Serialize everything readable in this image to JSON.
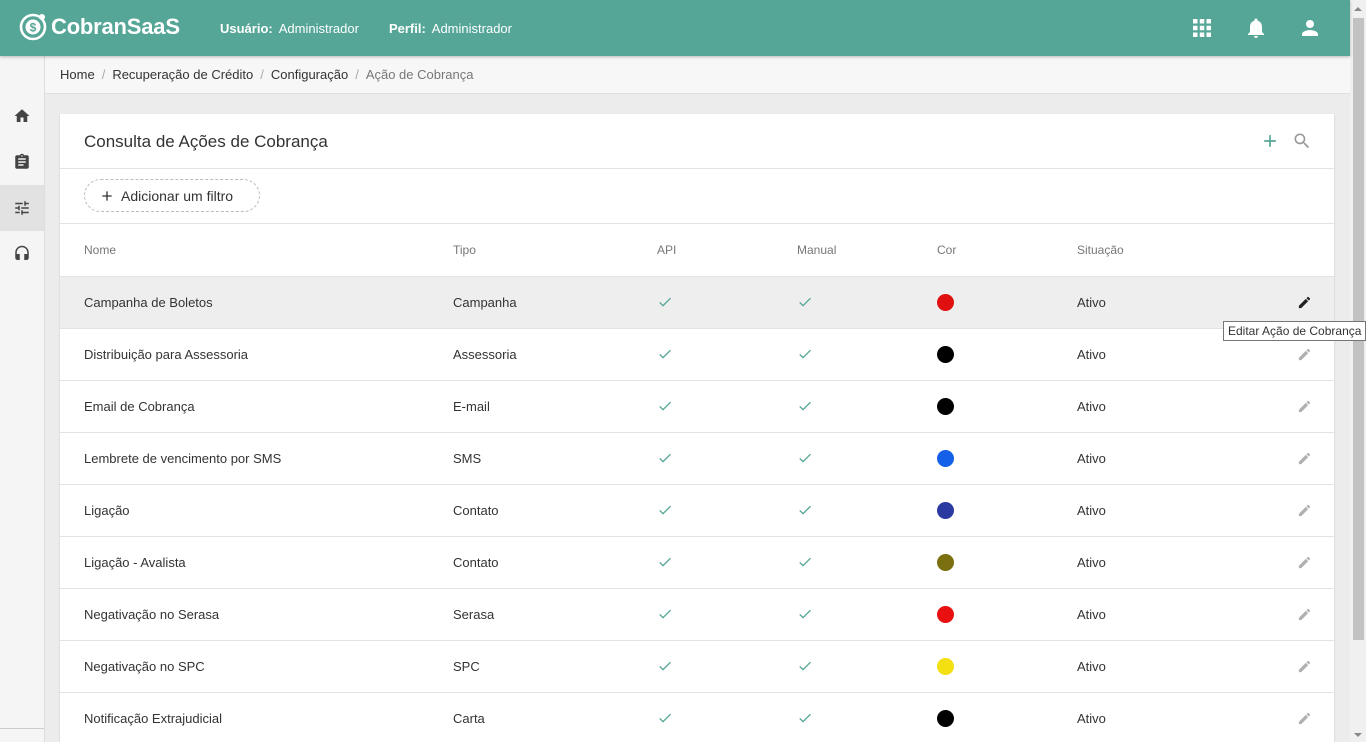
{
  "app": {
    "logo_text": "CobranSaaS",
    "colors": {
      "topbar": "#55a697",
      "accent": "#55a697"
    }
  },
  "header": {
    "user_label": "Usuário:",
    "user_value": "Administrador",
    "profile_label": "Perfil:",
    "profile_value": "Administrador",
    "icons": [
      "apps-grid-icon",
      "notifications-bell-icon",
      "account-icon"
    ]
  },
  "sidebar": {
    "items": [
      "home-icon",
      "clipboard-icon",
      "settings-sliders-icon",
      "headset-icon"
    ],
    "active": "settings-sliders-icon"
  },
  "breadcrumb": {
    "items": [
      "Home",
      "Recuperação de Crédito",
      "Configuração",
      "Ação de Cobrança"
    ],
    "separator": "/"
  },
  "card": {
    "title": "Consulta de Ações de Cobrança",
    "add_filter_label": "Adicionar um filtro",
    "columns": [
      "Nome",
      "Tipo",
      "API",
      "Manual",
      "Cor",
      "Situação"
    ],
    "rows": [
      {
        "nome": "Campanha de Boletos",
        "tipo": "Campanha",
        "api": true,
        "manual": true,
        "cor": "#e01010",
        "situacao": "Ativo"
      },
      {
        "nome": "Distribuição para Assessoria",
        "tipo": "Assessoria",
        "api": true,
        "manual": true,
        "cor": "#000000",
        "situacao": "Ativo"
      },
      {
        "nome": "Email de Cobrança",
        "tipo": "E-mail",
        "api": true,
        "manual": true,
        "cor": "#000000",
        "situacao": "Ativo"
      },
      {
        "nome": "Lembrete de vencimento por SMS",
        "tipo": "SMS",
        "api": true,
        "manual": true,
        "cor": "#1560e8",
        "situacao": "Ativo"
      },
      {
        "nome": "Ligação",
        "tipo": "Contato",
        "api": true,
        "manual": true,
        "cor": "#2a3aa0",
        "situacao": "Ativo"
      },
      {
        "nome": "Ligação - Avalista",
        "tipo": "Contato",
        "api": true,
        "manual": true,
        "cor": "#7a7010",
        "situacao": "Ativo"
      },
      {
        "nome": "Negativação no Serasa",
        "tipo": "Serasa",
        "api": true,
        "manual": true,
        "cor": "#e81010",
        "situacao": "Ativo"
      },
      {
        "nome": "Negativação no SPC",
        "tipo": "SPC",
        "api": true,
        "manual": true,
        "cor": "#f4e010",
        "situacao": "Ativo"
      },
      {
        "nome": "Notificação Extrajudicial",
        "tipo": "Carta",
        "api": true,
        "manual": true,
        "cor": "#000000",
        "situacao": "Ativo"
      }
    ],
    "hovered_row": 0,
    "tooltip": "Editar Ação de Cobrança"
  }
}
